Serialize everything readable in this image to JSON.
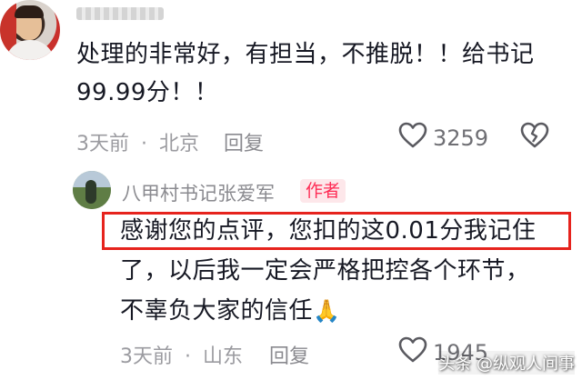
{
  "comment": {
    "avatar_icon": "user-avatar-photo",
    "lines": [
      "处理的非常好，有担当，不推脱！！给书记",
      "99.99分！！"
    ],
    "time": "3天前",
    "separator": "·",
    "location": "北京",
    "reply_label": "回复",
    "like_icon": "heart-outline-icon",
    "like_count": "3259",
    "dislike_icon": "broken-heart-icon"
  },
  "reply": {
    "avatar_icon": "user-avatar-photo",
    "username": "八甲村书记张爱军",
    "author_badge": "作者",
    "lines": [
      "感谢您的点评，您扣的这0.01分我记住",
      "了，以后我一定会严格把控各个环节，",
      "不辜负大家的信任"
    ],
    "emoji": "🙏",
    "time": "3天前",
    "separator": "·",
    "location": "山东",
    "reply_label": "回复",
    "like_icon": "heart-outline-icon",
    "like_count": "1945"
  },
  "watermark": "头条 @纵观人间事",
  "colors": {
    "accent": "#fe2c55",
    "highlight_border": "#e6231d",
    "meta_gray": "#9b9ba0"
  }
}
